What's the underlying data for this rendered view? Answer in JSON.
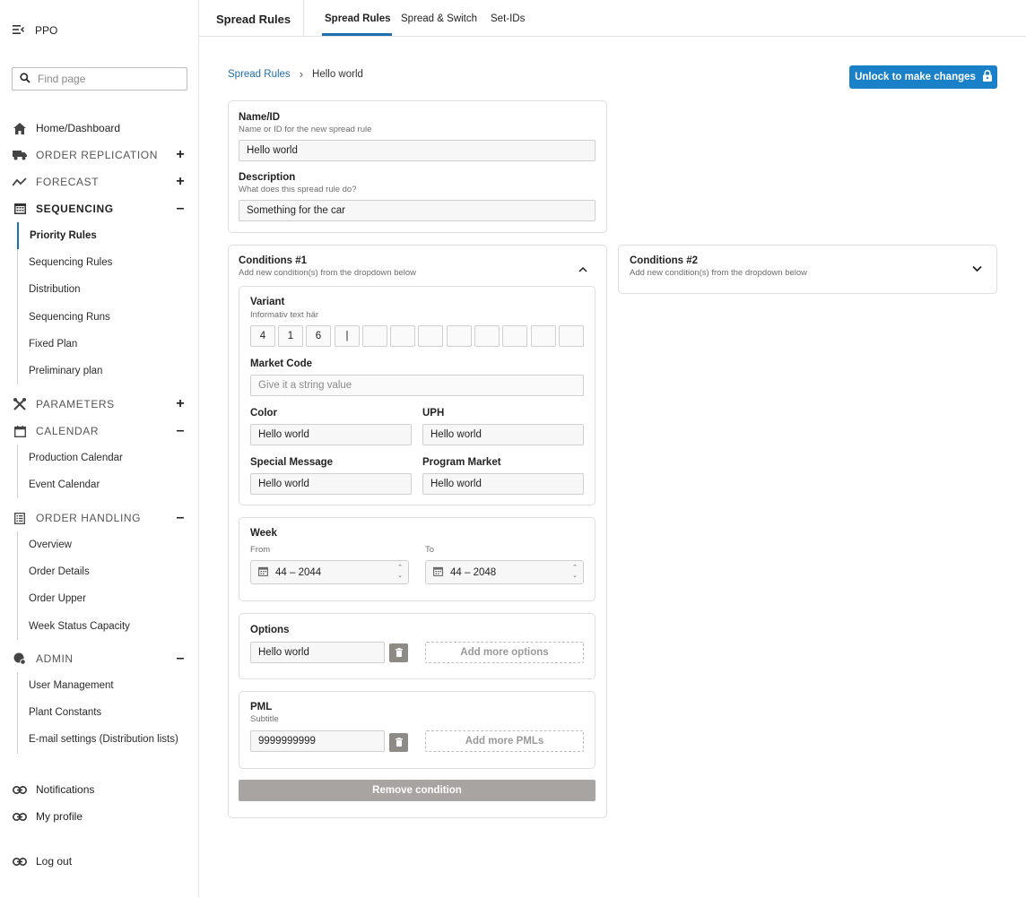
{
  "app": {
    "name": "PPO"
  },
  "search": {
    "placeholder": "Find page"
  },
  "nav": {
    "home": "Home/Dashboard",
    "order_replication": "ORDER REPLICATION",
    "forecast": "FORECAST",
    "sequencing": "SEQUENCING",
    "sequencing_items": [
      "Priority Rules",
      "Sequencing Rules",
      "Distribution",
      "Sequencing Runs",
      "Fixed Plan",
      "Preliminary plan"
    ],
    "parameters": "PARAMETERS",
    "calendar": "CALENDAR",
    "calendar_items": [
      "Production Calendar",
      "Event Calendar"
    ],
    "order_handling": "ORDER HANDLING",
    "order_handling_items": [
      "Overview",
      "Order Details",
      "Order Upper",
      "Week Status Capacity"
    ],
    "admin": "ADMIN",
    "admin_items": [
      "User Management",
      "Plant Constants",
      "E-mail settings (Distribution lists)"
    ],
    "notifications": "Notifications",
    "my_profile": "My profile",
    "log_out": "Log out"
  },
  "topbar": {
    "title": "Spread Rules",
    "tabs": [
      "Spread Rules",
      "Spread & Switch",
      "Set-IDs"
    ]
  },
  "breadcrumb": {
    "link": "Spread Rules",
    "current": "Hello world"
  },
  "actions": {
    "unlock": "Unlock to make changes"
  },
  "rule": {
    "name_label": "Name/ID",
    "name_help": "Name or ID for the new spread rule",
    "name_value": "Hello world",
    "desc_label": "Description",
    "desc_help": "What does this spread rule do?",
    "desc_value": "Something for the car"
  },
  "condition1": {
    "title": "Conditions #1",
    "subtitle": "Add new condition(s) from the dropdown below",
    "variant_label": "Variant",
    "variant_help": "Informativ text här",
    "variant_digits": [
      "4",
      "1",
      "6",
      "|",
      "",
      "",
      "",
      "",
      "",
      "",
      "",
      ""
    ],
    "market_code_label": "Market Code",
    "market_code_placeholder": "Give it a string value",
    "color_label": "Color",
    "color_value": "Hello world",
    "uph_label": "UPH",
    "uph_value": "Hello world",
    "special_label": "Special Message",
    "special_value": "Hello world",
    "program_label": "Program Market",
    "program_value": "Hello world",
    "week_label": "Week",
    "from_label": "From",
    "from_value": "44 – 2044",
    "to_label": "To",
    "to_value": "44 – 2048",
    "options_label": "Options",
    "options_value": "Hello world",
    "add_options": "Add more options",
    "pml_label": "PML",
    "pml_subtitle": "Subtitle",
    "pml_value": "9999999999",
    "add_pmls": "Add more PMLs",
    "remove": "Remove condition"
  },
  "condition2": {
    "title": "Conditions #2",
    "subtitle": "Add new condition(s) from the dropdown below"
  },
  "colors": {
    "accent": "#1a81c9",
    "link": "#1f6fae",
    "disabled": "#a8a4a1"
  }
}
